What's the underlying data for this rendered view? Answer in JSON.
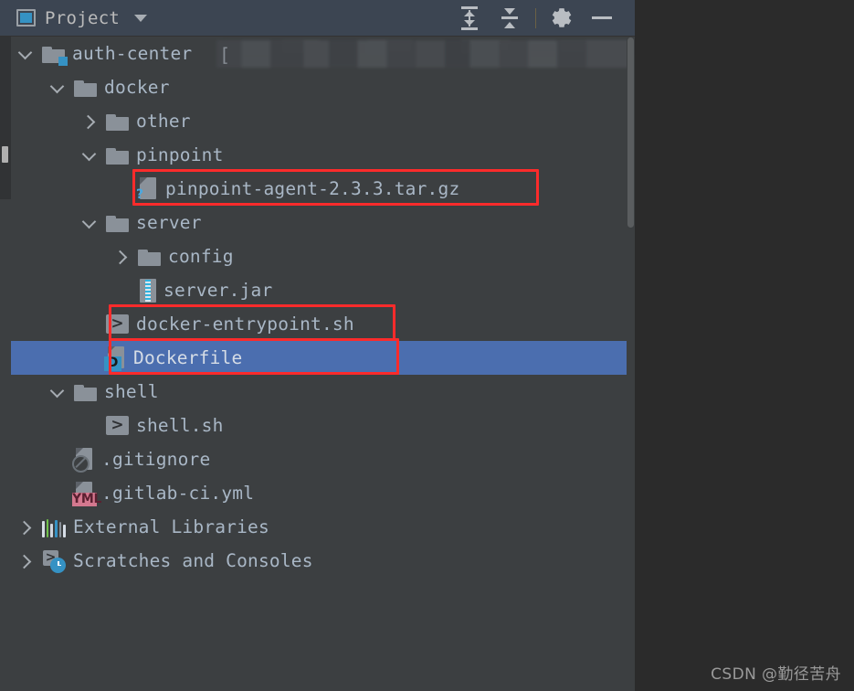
{
  "header": {
    "title": "Project",
    "icon": "project-window-icon",
    "dropdown_icon": "chevron-down-icon",
    "buttons": [
      {
        "name": "expand-all-button",
        "label": "Expand All",
        "icon": "expand-all-icon"
      },
      {
        "name": "collapse-all-button",
        "label": "Collapse All",
        "icon": "collapse-all-icon"
      },
      {
        "name": "settings-button",
        "label": "Settings",
        "icon": "gear-icon"
      },
      {
        "name": "hide-button",
        "label": "Hide",
        "icon": "minus-icon"
      }
    ]
  },
  "tree": {
    "rows": [
      {
        "label": "auth-center",
        "icon": "module-folder-icon",
        "state": "open",
        "depth": 0,
        "selected": false,
        "redacted_suffix": true
      },
      {
        "label": "docker",
        "icon": "folder-icon",
        "state": "open",
        "depth": 1,
        "selected": false
      },
      {
        "label": "other",
        "icon": "folder-icon",
        "state": "closed",
        "depth": 2,
        "selected": false
      },
      {
        "label": "pinpoint",
        "icon": "folder-icon",
        "state": "open",
        "depth": 2,
        "selected": false
      },
      {
        "label": "pinpoint-agent-2.3.3.tar.gz",
        "icon": "unknown-file-icon",
        "state": "leaf",
        "depth": 3,
        "selected": false
      },
      {
        "label": "server",
        "icon": "folder-icon",
        "state": "open",
        "depth": 2,
        "selected": false
      },
      {
        "label": "config",
        "icon": "folder-icon",
        "state": "closed",
        "depth": 3,
        "selected": false
      },
      {
        "label": "server.jar",
        "icon": "jar-archive-icon",
        "state": "leaf",
        "depth": 3,
        "selected": false
      },
      {
        "label": "docker-entrypoint.sh",
        "icon": "shell-script-icon",
        "state": "leaf",
        "depth": 2,
        "selected": false
      },
      {
        "label": "Dockerfile",
        "icon": "dockerfile-icon",
        "state": "leaf",
        "depth": 2,
        "selected": true
      },
      {
        "label": "shell",
        "icon": "folder-icon",
        "state": "open",
        "depth": 1,
        "selected": false
      },
      {
        "label": "shell.sh",
        "icon": "shell-script-icon",
        "state": "leaf",
        "depth": 2,
        "selected": false
      },
      {
        "label": ".gitignore",
        "icon": "gitignore-file-icon",
        "state": "leaf",
        "depth": 1,
        "selected": false
      },
      {
        "label": ".gitlab-ci.yml",
        "icon": "yaml-file-icon",
        "state": "leaf",
        "depth": 1,
        "selected": false
      },
      {
        "label": "External Libraries",
        "icon": "libraries-icon",
        "state": "closed",
        "depth": 0,
        "selected": false
      },
      {
        "label": "Scratches and Consoles",
        "icon": "scratches-icon",
        "state": "closed",
        "depth": 0,
        "selected": false
      }
    ]
  },
  "annotations": {
    "highlight_color": "#fb2b2b",
    "boxes": [
      {
        "name": "annotation-box-pinpoint-agent",
        "target": "pinpoint-agent-2.3.3.tar.gz"
      },
      {
        "name": "annotation-box-docker-entrypoint",
        "target": "docker-entrypoint.sh"
      },
      {
        "name": "annotation-box-dockerfile",
        "target": "Dockerfile"
      }
    ]
  },
  "colors": {
    "panel_bg": "#3c3f41",
    "header_bg": "#3c4552",
    "selection_bg": "#4b6eaf",
    "text": "#a9b7c6",
    "accent": "#3592c4",
    "canvas_bg": "#2b2b2b"
  },
  "badges": {
    "unknown": "?",
    "docker": "D",
    "yaml": "YML"
  },
  "watermark": "CSDN @勤径苦舟"
}
